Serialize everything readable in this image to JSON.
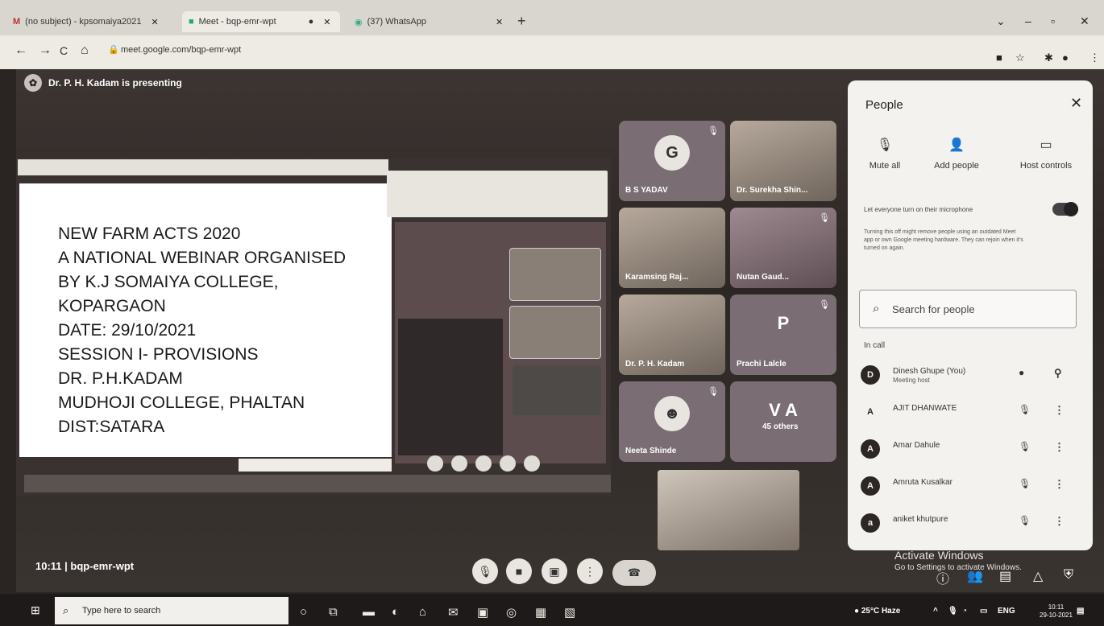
{
  "browser": {
    "tabs": [
      {
        "label": "(no subject) - kpsomaiya2021"
      },
      {
        "label": "Meet - bqp-emr-wpt"
      },
      {
        "label": "(37) WhatsApp"
      }
    ],
    "new_tab": "+",
    "url": "meet.google.com/bqp-emr-wpt",
    "controls": {
      "back": "←",
      "forward": "→",
      "reload": "C",
      "home": "⌂"
    }
  },
  "meet": {
    "presenting_label": "Dr. P. H. Kadam is presenting",
    "slide_lines": [
      "NEW FARM ACTS 2020",
      "A NATIONAL WEBINAR ORGANISED",
      "BY K.J SOMAIYA COLLEGE,",
      "KOPARGAON",
      "DATE: 29/10/2021",
      "SESSION I- PROVISIONS",
      "DR. P.H.KADAM",
      "MUDHOJI COLLEGE, PHALTAN",
      "DIST:SATARA"
    ],
    "tiles": [
      {
        "name": "B S YADAV",
        "avatar": "G"
      },
      {
        "name": "Dr. Surekha Shin..."
      },
      {
        "name": "Karamsing Raj..."
      },
      {
        "name": "Nutan Gaud..."
      },
      {
        "name": "Dr. P. H. Kadam"
      },
      {
        "name": "Prachi Lalcle",
        "letter": "P"
      },
      {
        "name": "Neeta Shinde"
      },
      {
        "name": "45 others",
        "letter": "V A"
      }
    ],
    "meeting_info": "10:11 | bqp-emr-wpt",
    "activate_title": "Activate Windows",
    "activate_sub": "Go to Settings to activate Windows."
  },
  "people_panel": {
    "title": "People",
    "actions": [
      {
        "label": "Mute all",
        "icon": "mic-off-icon"
      },
      {
        "label": "Add people",
        "icon": "add-person-icon"
      },
      {
        "label": "Host controls",
        "icon": "host-controls-icon"
      }
    ],
    "toggle_label": "Let everyone turn on their microphone",
    "help_text": "Turning this off might remove people using an outdated Meet app or own Google meeting hardware. They can rejoin when it's turned on again.",
    "search_placeholder": "Search for people",
    "in_call_label": "In call",
    "participants": [
      {
        "name": "Dinesh Ghupe (You)",
        "sub": "Meeting host",
        "initial": "D"
      },
      {
        "name": "AJIT DHANWATE",
        "sub": "",
        "initial": "A"
      },
      {
        "name": "Amar Dahule",
        "sub": "",
        "initial": "A"
      },
      {
        "name": "Amruta Kusalkar",
        "sub": "",
        "initial": "A"
      },
      {
        "name": "aniket khutpure",
        "sub": "",
        "initial": "a"
      }
    ]
  },
  "taskbar": {
    "search_placeholder": "Type here to search",
    "weather": "25°C Haze",
    "lang": "ENG",
    "time": "10:11",
    "date": "29-10-2021"
  }
}
